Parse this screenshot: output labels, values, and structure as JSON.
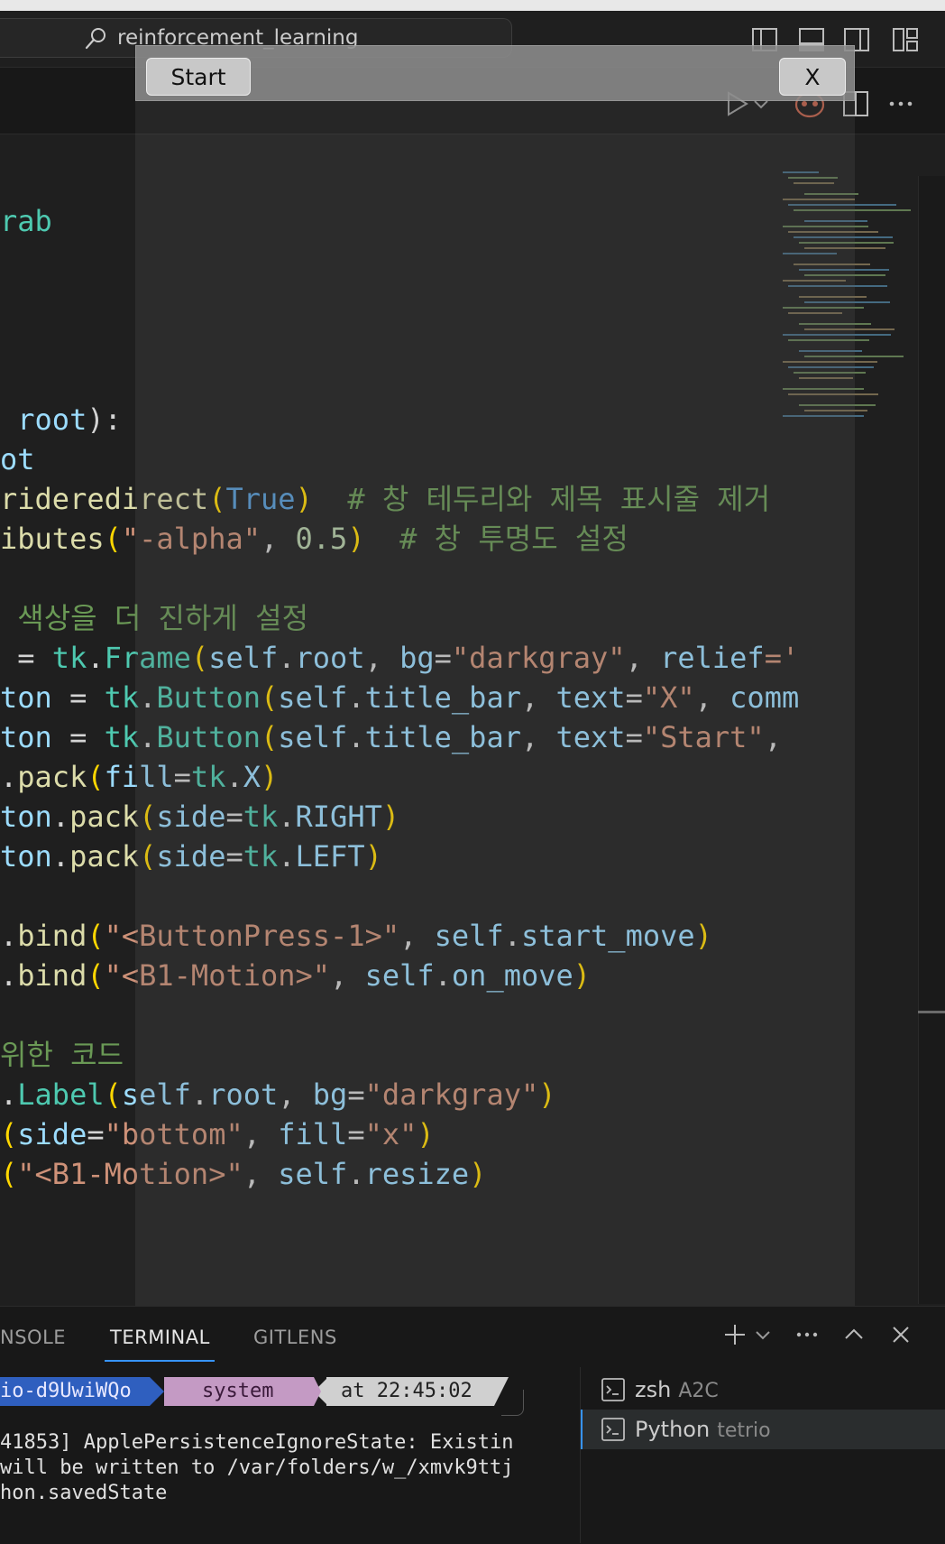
{
  "titlebar": {
    "search_text": "reinforcement_learning"
  },
  "overlay_window": {
    "start_label": "Start",
    "close_label": "X"
  },
  "code_lines": [
    {
      "id": "l1",
      "parts": [
        {
          "t": "rab",
          "c": "c-teal"
        }
      ]
    },
    {
      "id": "l2",
      "parts": [
        {
          "t": " root",
          "c": "c-var"
        },
        {
          "t": "):",
          "c": "c-white"
        }
      ]
    },
    {
      "id": "l3",
      "parts": [
        {
          "t": "ot",
          "c": "c-var"
        }
      ]
    },
    {
      "id": "l4",
      "parts": [
        {
          "t": "rideredirect",
          "c": "c-yellow"
        },
        {
          "t": "(",
          "c": "c-paren"
        },
        {
          "t": "True",
          "c": "c-blue"
        },
        {
          "t": ")  ",
          "c": "c-paren"
        },
        {
          "t": "# 창 테두리와 제목 표시줄 제거",
          "c": "c-cmt"
        }
      ]
    },
    {
      "id": "l5",
      "parts": [
        {
          "t": "ibutes",
          "c": "c-yellow"
        },
        {
          "t": "(",
          "c": "c-paren"
        },
        {
          "t": "\"-alpha\"",
          "c": "c-str"
        },
        {
          "t": ", ",
          "c": "c-white"
        },
        {
          "t": "0.5",
          "c": "c-num"
        },
        {
          "t": ")  ",
          "c": "c-paren"
        },
        {
          "t": "# 창 투명도 설정",
          "c": "c-cmt"
        }
      ]
    },
    {
      "id": "l6",
      "parts": [
        {
          "t": " 색상을 더 진하게 설정",
          "c": "c-cmt"
        }
      ]
    },
    {
      "id": "l7",
      "parts": [
        {
          "t": " = ",
          "c": "c-white"
        },
        {
          "t": "tk",
          "c": "c-teal"
        },
        {
          "t": ".",
          "c": "c-white"
        },
        {
          "t": "Frame",
          "c": "c-teal"
        },
        {
          "t": "(",
          "c": "c-paren"
        },
        {
          "t": "self",
          "c": "c-var"
        },
        {
          "t": ".",
          "c": "c-white"
        },
        {
          "t": "root",
          "c": "c-var"
        },
        {
          "t": ", ",
          "c": "c-white"
        },
        {
          "t": "bg",
          "c": "c-param"
        },
        {
          "t": "=",
          "c": "c-white"
        },
        {
          "t": "\"darkgray\"",
          "c": "c-str"
        },
        {
          "t": ", ",
          "c": "c-white"
        },
        {
          "t": "relief",
          "c": "c-param"
        },
        {
          "t": "='",
          "c": "c-str"
        }
      ]
    },
    {
      "id": "l8",
      "parts": [
        {
          "t": "ton",
          "c": "c-var"
        },
        {
          "t": " = ",
          "c": "c-white"
        },
        {
          "t": "tk",
          "c": "c-teal"
        },
        {
          "t": ".",
          "c": "c-white"
        },
        {
          "t": "Button",
          "c": "c-teal"
        },
        {
          "t": "(",
          "c": "c-paren"
        },
        {
          "t": "self",
          "c": "c-var"
        },
        {
          "t": ".",
          "c": "c-white"
        },
        {
          "t": "title_bar",
          "c": "c-var"
        },
        {
          "t": ", ",
          "c": "c-white"
        },
        {
          "t": "text",
          "c": "c-param"
        },
        {
          "t": "=",
          "c": "c-white"
        },
        {
          "t": "\"X\"",
          "c": "c-str"
        },
        {
          "t": ", ",
          "c": "c-white"
        },
        {
          "t": "comm",
          "c": "c-param"
        }
      ]
    },
    {
      "id": "l9",
      "parts": [
        {
          "t": "ton",
          "c": "c-var"
        },
        {
          "t": " = ",
          "c": "c-white"
        },
        {
          "t": "tk",
          "c": "c-teal"
        },
        {
          "t": ".",
          "c": "c-white"
        },
        {
          "t": "Button",
          "c": "c-teal"
        },
        {
          "t": "(",
          "c": "c-paren"
        },
        {
          "t": "self",
          "c": "c-var"
        },
        {
          "t": ".",
          "c": "c-white"
        },
        {
          "t": "title_bar",
          "c": "c-var"
        },
        {
          "t": ", ",
          "c": "c-white"
        },
        {
          "t": "text",
          "c": "c-param"
        },
        {
          "t": "=",
          "c": "c-white"
        },
        {
          "t": "\"Start\"",
          "c": "c-str"
        },
        {
          "t": ",",
          "c": "c-white"
        }
      ]
    },
    {
      "id": "l10",
      "parts": [
        {
          "t": ".",
          "c": "c-white"
        },
        {
          "t": "pack",
          "c": "c-yellow"
        },
        {
          "t": "(",
          "c": "c-paren"
        },
        {
          "t": "fill",
          "c": "c-param"
        },
        {
          "t": "=",
          "c": "c-white"
        },
        {
          "t": "tk",
          "c": "c-teal"
        },
        {
          "t": ".",
          "c": "c-white"
        },
        {
          "t": "X",
          "c": "c-var"
        },
        {
          "t": ")",
          "c": "c-paren"
        }
      ]
    },
    {
      "id": "l11",
      "parts": [
        {
          "t": "ton",
          "c": "c-var"
        },
        {
          "t": ".",
          "c": "c-white"
        },
        {
          "t": "pack",
          "c": "c-yellow"
        },
        {
          "t": "(",
          "c": "c-paren"
        },
        {
          "t": "side",
          "c": "c-param"
        },
        {
          "t": "=",
          "c": "c-white"
        },
        {
          "t": "tk",
          "c": "c-teal"
        },
        {
          "t": ".",
          "c": "c-white"
        },
        {
          "t": "RIGHT",
          "c": "c-var"
        },
        {
          "t": ")",
          "c": "c-paren"
        }
      ]
    },
    {
      "id": "l12",
      "parts": [
        {
          "t": "ton",
          "c": "c-var"
        },
        {
          "t": ".",
          "c": "c-white"
        },
        {
          "t": "pack",
          "c": "c-yellow"
        },
        {
          "t": "(",
          "c": "c-paren"
        },
        {
          "t": "side",
          "c": "c-param"
        },
        {
          "t": "=",
          "c": "c-white"
        },
        {
          "t": "tk",
          "c": "c-teal"
        },
        {
          "t": ".",
          "c": "c-white"
        },
        {
          "t": "LEFT",
          "c": "c-var"
        },
        {
          "t": ")",
          "c": "c-paren"
        }
      ]
    },
    {
      "id": "l13",
      "parts": [
        {
          "t": ".",
          "c": "c-white"
        },
        {
          "t": "bind",
          "c": "c-yellow"
        },
        {
          "t": "(",
          "c": "c-paren"
        },
        {
          "t": "\"<ButtonPress-1>\"",
          "c": "c-str"
        },
        {
          "t": ", ",
          "c": "c-white"
        },
        {
          "t": "self",
          "c": "c-var"
        },
        {
          "t": ".",
          "c": "c-white"
        },
        {
          "t": "start_move",
          "c": "c-var"
        },
        {
          "t": ")",
          "c": "c-paren"
        }
      ]
    },
    {
      "id": "l14",
      "parts": [
        {
          "t": ".",
          "c": "c-white"
        },
        {
          "t": "bind",
          "c": "c-yellow"
        },
        {
          "t": "(",
          "c": "c-paren"
        },
        {
          "t": "\"<B1-Motion>\"",
          "c": "c-str"
        },
        {
          "t": ", ",
          "c": "c-white"
        },
        {
          "t": "self",
          "c": "c-var"
        },
        {
          "t": ".",
          "c": "c-white"
        },
        {
          "t": "on_move",
          "c": "c-var"
        },
        {
          "t": ")",
          "c": "c-paren"
        }
      ]
    },
    {
      "id": "l15",
      "parts": [
        {
          "t": "위한 코드",
          "c": "c-cmt"
        }
      ]
    },
    {
      "id": "l16",
      "parts": [
        {
          "t": ".",
          "c": "c-white"
        },
        {
          "t": "Label",
          "c": "c-teal"
        },
        {
          "t": "(",
          "c": "c-paren"
        },
        {
          "t": "self",
          "c": "c-var"
        },
        {
          "t": ".",
          "c": "c-white"
        },
        {
          "t": "root",
          "c": "c-var"
        },
        {
          "t": ", ",
          "c": "c-white"
        },
        {
          "t": "bg",
          "c": "c-param"
        },
        {
          "t": "=",
          "c": "c-white"
        },
        {
          "t": "\"darkgray\"",
          "c": "c-str"
        },
        {
          "t": ")",
          "c": "c-paren"
        }
      ]
    },
    {
      "id": "l17",
      "parts": [
        {
          "t": "(",
          "c": "c-paren"
        },
        {
          "t": "side",
          "c": "c-param"
        },
        {
          "t": "=",
          "c": "c-white"
        },
        {
          "t": "\"bottom\"",
          "c": "c-str"
        },
        {
          "t": ", ",
          "c": "c-white"
        },
        {
          "t": "fill",
          "c": "c-param"
        },
        {
          "t": "=",
          "c": "c-white"
        },
        {
          "t": "\"x\"",
          "c": "c-str"
        },
        {
          "t": ")",
          "c": "c-paren"
        }
      ]
    },
    {
      "id": "l18",
      "parts": [
        {
          "t": "(",
          "c": "c-paren"
        },
        {
          "t": "\"<B1-Motion>\"",
          "c": "c-str"
        },
        {
          "t": ", ",
          "c": "c-white"
        },
        {
          "t": "self",
          "c": "c-var"
        },
        {
          "t": ".",
          "c": "c-white"
        },
        {
          "t": "resize",
          "c": "c-var"
        },
        {
          "t": ")",
          "c": "c-paren"
        }
      ]
    }
  ],
  "panel": {
    "tabs": [
      {
        "label": "NSOLE"
      },
      {
        "label": "TERMINAL"
      },
      {
        "label": "GITLENS"
      }
    ],
    "prompt": {
      "segment1": "io-d9UwiWQo",
      "segment2": "system",
      "segment3": "at 22:45:02"
    },
    "output_lines": [
      "41853] ApplePersistenceIgnoreState: Existin",
      "will be written to /var/folders/w_/xmvk9ttj",
      "hon.savedState"
    ],
    "terminals": [
      {
        "name": "zsh",
        "detail": "A2C"
      },
      {
        "name": "Python",
        "detail": "tetrio"
      }
    ]
  },
  "colors": {
    "accent": "#3794ff",
    "prompt_bg1": "#2f5fbf",
    "prompt_bg2": "#c49ac4",
    "prompt_bg3": "#d0d0d0"
  }
}
